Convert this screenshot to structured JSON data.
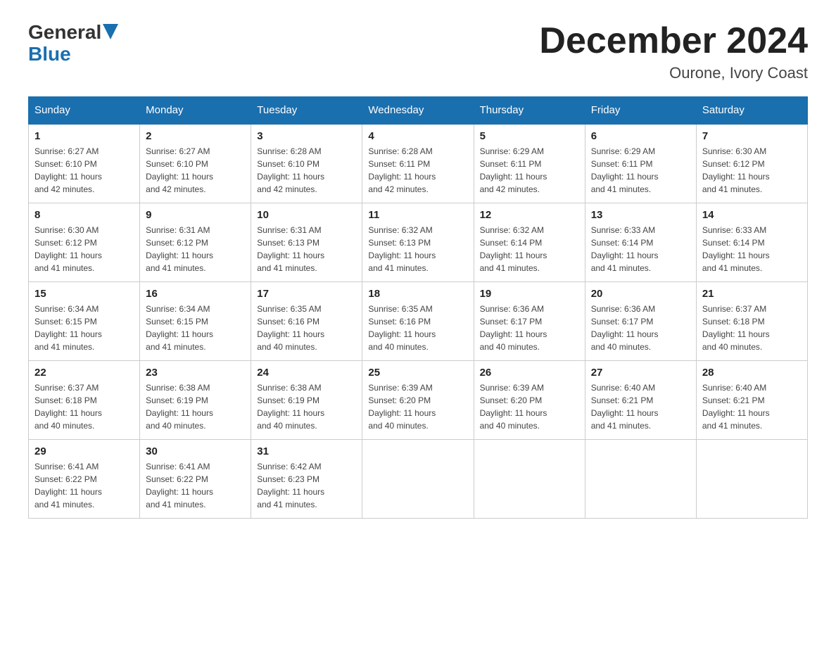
{
  "header": {
    "logo_general": "General",
    "logo_blue": "Blue",
    "title": "December 2024",
    "location": "Ourone, Ivory Coast"
  },
  "days_of_week": [
    "Sunday",
    "Monday",
    "Tuesday",
    "Wednesday",
    "Thursday",
    "Friday",
    "Saturday"
  ],
  "weeks": [
    [
      {
        "day": "1",
        "sunrise": "6:27 AM",
        "sunset": "6:10 PM",
        "daylight": "11 hours and 42 minutes."
      },
      {
        "day": "2",
        "sunrise": "6:27 AM",
        "sunset": "6:10 PM",
        "daylight": "11 hours and 42 minutes."
      },
      {
        "day": "3",
        "sunrise": "6:28 AM",
        "sunset": "6:10 PM",
        "daylight": "11 hours and 42 minutes."
      },
      {
        "day": "4",
        "sunrise": "6:28 AM",
        "sunset": "6:11 PM",
        "daylight": "11 hours and 42 minutes."
      },
      {
        "day": "5",
        "sunrise": "6:29 AM",
        "sunset": "6:11 PM",
        "daylight": "11 hours and 42 minutes."
      },
      {
        "day": "6",
        "sunrise": "6:29 AM",
        "sunset": "6:11 PM",
        "daylight": "11 hours and 41 minutes."
      },
      {
        "day": "7",
        "sunrise": "6:30 AM",
        "sunset": "6:12 PM",
        "daylight": "11 hours and 41 minutes."
      }
    ],
    [
      {
        "day": "8",
        "sunrise": "6:30 AM",
        "sunset": "6:12 PM",
        "daylight": "11 hours and 41 minutes."
      },
      {
        "day": "9",
        "sunrise": "6:31 AM",
        "sunset": "6:12 PM",
        "daylight": "11 hours and 41 minutes."
      },
      {
        "day": "10",
        "sunrise": "6:31 AM",
        "sunset": "6:13 PM",
        "daylight": "11 hours and 41 minutes."
      },
      {
        "day": "11",
        "sunrise": "6:32 AM",
        "sunset": "6:13 PM",
        "daylight": "11 hours and 41 minutes."
      },
      {
        "day": "12",
        "sunrise": "6:32 AM",
        "sunset": "6:14 PM",
        "daylight": "11 hours and 41 minutes."
      },
      {
        "day": "13",
        "sunrise": "6:33 AM",
        "sunset": "6:14 PM",
        "daylight": "11 hours and 41 minutes."
      },
      {
        "day": "14",
        "sunrise": "6:33 AM",
        "sunset": "6:14 PM",
        "daylight": "11 hours and 41 minutes."
      }
    ],
    [
      {
        "day": "15",
        "sunrise": "6:34 AM",
        "sunset": "6:15 PM",
        "daylight": "11 hours and 41 minutes."
      },
      {
        "day": "16",
        "sunrise": "6:34 AM",
        "sunset": "6:15 PM",
        "daylight": "11 hours and 41 minutes."
      },
      {
        "day": "17",
        "sunrise": "6:35 AM",
        "sunset": "6:16 PM",
        "daylight": "11 hours and 40 minutes."
      },
      {
        "day": "18",
        "sunrise": "6:35 AM",
        "sunset": "6:16 PM",
        "daylight": "11 hours and 40 minutes."
      },
      {
        "day": "19",
        "sunrise": "6:36 AM",
        "sunset": "6:17 PM",
        "daylight": "11 hours and 40 minutes."
      },
      {
        "day": "20",
        "sunrise": "6:36 AM",
        "sunset": "6:17 PM",
        "daylight": "11 hours and 40 minutes."
      },
      {
        "day": "21",
        "sunrise": "6:37 AM",
        "sunset": "6:18 PM",
        "daylight": "11 hours and 40 minutes."
      }
    ],
    [
      {
        "day": "22",
        "sunrise": "6:37 AM",
        "sunset": "6:18 PM",
        "daylight": "11 hours and 40 minutes."
      },
      {
        "day": "23",
        "sunrise": "6:38 AM",
        "sunset": "6:19 PM",
        "daylight": "11 hours and 40 minutes."
      },
      {
        "day": "24",
        "sunrise": "6:38 AM",
        "sunset": "6:19 PM",
        "daylight": "11 hours and 40 minutes."
      },
      {
        "day": "25",
        "sunrise": "6:39 AM",
        "sunset": "6:20 PM",
        "daylight": "11 hours and 40 minutes."
      },
      {
        "day": "26",
        "sunrise": "6:39 AM",
        "sunset": "6:20 PM",
        "daylight": "11 hours and 40 minutes."
      },
      {
        "day": "27",
        "sunrise": "6:40 AM",
        "sunset": "6:21 PM",
        "daylight": "11 hours and 41 minutes."
      },
      {
        "day": "28",
        "sunrise": "6:40 AM",
        "sunset": "6:21 PM",
        "daylight": "11 hours and 41 minutes."
      }
    ],
    [
      {
        "day": "29",
        "sunrise": "6:41 AM",
        "sunset": "6:22 PM",
        "daylight": "11 hours and 41 minutes."
      },
      {
        "day": "30",
        "sunrise": "6:41 AM",
        "sunset": "6:22 PM",
        "daylight": "11 hours and 41 minutes."
      },
      {
        "day": "31",
        "sunrise": "6:42 AM",
        "sunset": "6:23 PM",
        "daylight": "11 hours and 41 minutes."
      },
      null,
      null,
      null,
      null
    ]
  ],
  "labels": {
    "sunrise": "Sunrise:",
    "sunset": "Sunset:",
    "daylight": "Daylight:"
  }
}
